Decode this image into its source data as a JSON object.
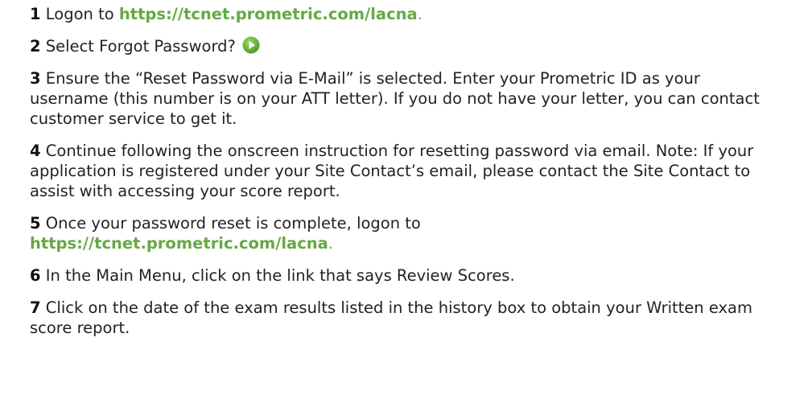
{
  "steps": [
    {
      "number": "1",
      "before": "Logon to ",
      "link": "https://tcnet.prometric.com/lacna",
      "after": "."
    },
    {
      "number": "2",
      "text": "Select Forgot Password?",
      "icon": "play-circle-icon",
      "icon_color": "#6fb83f"
    },
    {
      "number": "3",
      "text": "Ensure the “Reset Password via E-Mail” is selected. Enter your Prometric ID as your username (this number is on your ATT letter). If you do not have your letter, you can contact customer service to get it."
    },
    {
      "number": "4",
      "text": "Continue following the onscreen instruction for resetting password via email. Note: If your application is registered under your Site Contact’s email, please contact the Site Contact to assist with accessing your score report."
    },
    {
      "number": "5",
      "before": "Once your password reset is complete, logon to",
      "link": "https://tcnet.prometric.com/lacna",
      "after": "."
    },
    {
      "number": "6",
      "text": "In the Main Menu, click on the link that says Review Scores."
    },
    {
      "number": "7",
      "text": "Click on the date of the exam results listed in the history box to obtain your Written exam score report."
    }
  ],
  "colors": {
    "link": "#65a843",
    "text": "#222222"
  }
}
